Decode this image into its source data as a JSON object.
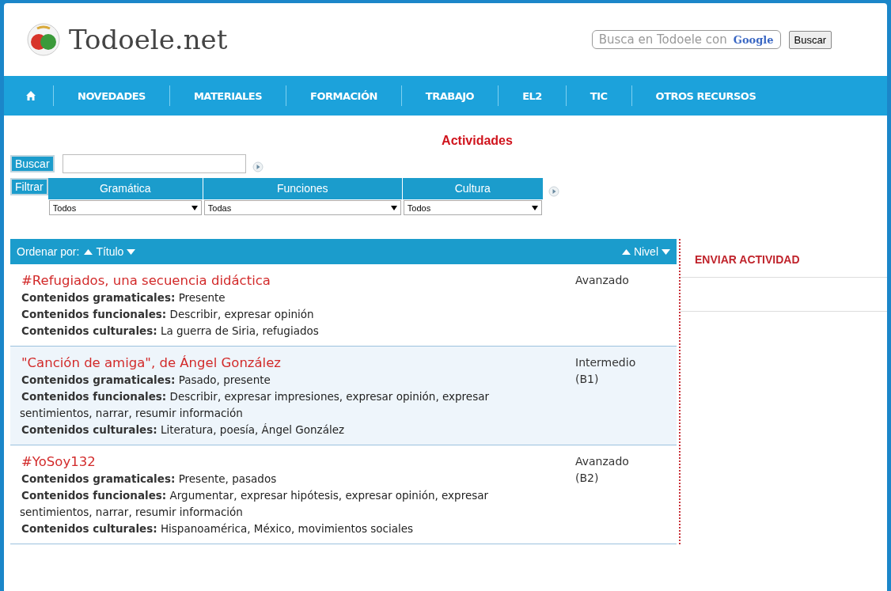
{
  "header": {
    "site_name": "Todoele.net",
    "search": {
      "placeholder": "Busca en Todoele con",
      "brand": "Google"
    },
    "search_button": "Buscar"
  },
  "nav": [
    {
      "kind": "home"
    },
    {
      "kind": "link",
      "label": "NOVEDADES"
    },
    {
      "kind": "link",
      "label": "MATERIALES"
    },
    {
      "kind": "link",
      "label": "FORMACIÓN"
    },
    {
      "kind": "link",
      "label": "TRABAJO"
    },
    {
      "kind": "link",
      "label": "EL2"
    },
    {
      "kind": "link",
      "label": "TIC"
    },
    {
      "kind": "link",
      "label": "OTROS RECURSOS"
    }
  ],
  "page_title": "Actividades",
  "search": {
    "button": "Buscar"
  },
  "filter": {
    "button": "Filtrar",
    "columns": [
      {
        "label": "Gramática",
        "value": "Todos"
      },
      {
        "label": "Funciones",
        "value": "Todas"
      },
      {
        "label": "Cultura",
        "value": "Todos"
      }
    ]
  },
  "list_header": {
    "sort_label": "Ordenar por:",
    "title_sort": "Título",
    "level_sort": "Nivel"
  },
  "activities": [
    {
      "title": "#Refugiados, una secuencia didáctica",
      "level": "Avanzado",
      "lines": [
        "**Contenidos gramaticales:** Presente",
        "**Contenidos funcionales:** Describir, expresar opinión",
        "**Contenidos culturales:** La guerra de Siria, refugiados"
      ],
      "highlighted": false
    },
    {
      "title": "\"Canción de amiga\", de Ángel González",
      "level": "Intermedio (B1)",
      "lines": [
        "**Contenidos gramaticales:** Pasado, presente",
        "**Contenidos funcionales:** Describir, expresar impresiones, expresar opinión, expresar sentimientos, narrar, resumir información",
        "**Contenidos culturales:** Literatura, poesía, Ángel González"
      ],
      "highlighted": true
    },
    {
      "title": "#YoSoy132",
      "level": "Avanzado (B2)",
      "lines": [
        "**Contenidos gramaticales:** Presente, pasados",
        "**Contenidos funcionales:** Argumentar, expresar hipótesis, expresar opinión, expresar sentimientos, narrar, resumir información",
        "**Contenidos culturales:** Hispanoamérica, México, movimientos sociales"
      ],
      "highlighted": false
    }
  ],
  "sidebar": {
    "link": "ENVIAR ACTIVIDAD"
  }
}
